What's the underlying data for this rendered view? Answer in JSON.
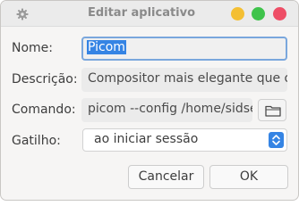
{
  "window": {
    "title": "Editar aplicativo"
  },
  "form": {
    "name_label": "Nome:",
    "name_value": "Picom",
    "description_label": "Descrição:",
    "description_value": "Compositor mais elegante que o xfwm",
    "command_label": "Comando:",
    "command_value": "picom --config /home/sidserra/.config/picom.conf",
    "trigger_label": "Gatilho:",
    "trigger_value": "ao iniciar sessão"
  },
  "buttons": {
    "cancel": "Cancelar",
    "ok": "OK"
  },
  "icons": {
    "window_menu": "gear-icon",
    "browse": "folder-icon",
    "combo": "chevron-up-down-icon"
  },
  "colors": {
    "accent": "#3584e4",
    "minimize": "#f4bf33",
    "maximize": "#3fc34b",
    "close": "#ee4e66"
  }
}
